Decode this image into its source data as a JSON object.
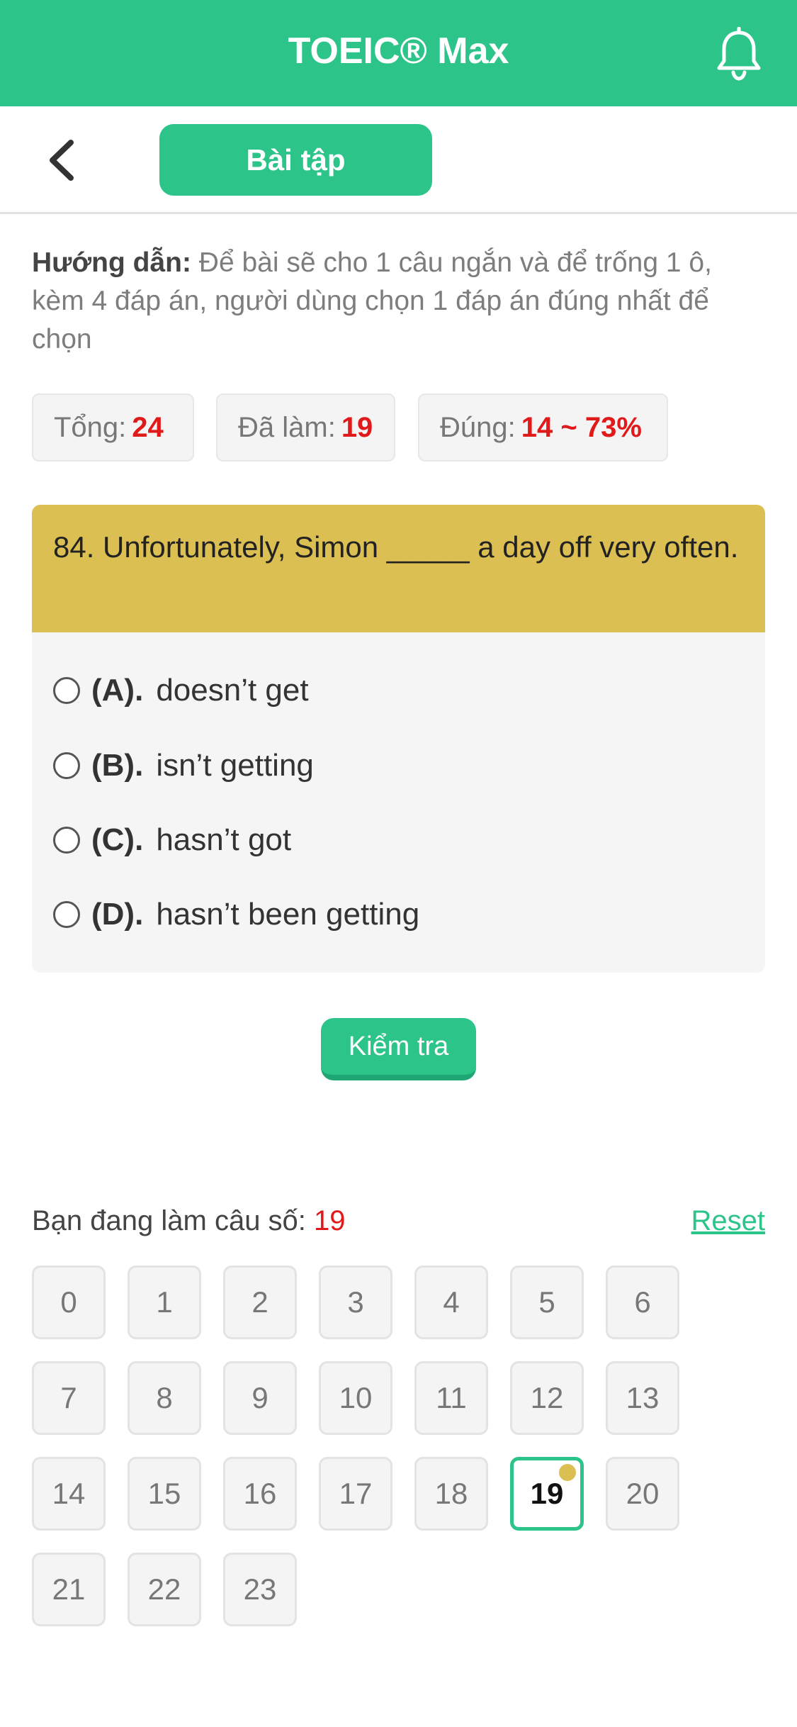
{
  "app": {
    "title": "TOEIC® Max"
  },
  "toolbar": {
    "tab_label": "Bài tập"
  },
  "instruction": {
    "label": "Hướng dẫn:",
    "text": "Để bài sẽ cho 1 câu ngắn và để trống 1 ô, kèm 4 đáp án, người dùng chọn 1 đáp án đúng nhất để chọn"
  },
  "stats": [
    {
      "label": "Tổng:",
      "value": "24"
    },
    {
      "label": "Đã làm:",
      "value": "19"
    },
    {
      "label": "Đúng:",
      "value": "14 ~ 73%"
    }
  ],
  "question": {
    "text": "84. Unfortunately, Simon _____ a day off very often.",
    "options": [
      {
        "letter": "(A).",
        "text": "doesn’t get"
      },
      {
        "letter": "(B).",
        "text": "isn’t getting"
      },
      {
        "letter": "(C).",
        "text": "hasn’t got"
      },
      {
        "letter": "(D).",
        "text": "hasn’t been getting"
      }
    ]
  },
  "check_button": {
    "label": "Kiểm tra"
  },
  "progress": {
    "label": "Bạn đang làm câu số:",
    "current": "19",
    "reset_label": "Reset"
  },
  "grid": [
    "0",
    "1",
    "2",
    "3",
    "4",
    "5",
    "6",
    "7",
    "8",
    "9",
    "10",
    "11",
    "12",
    "13",
    "14",
    "15",
    "16",
    "17",
    "18",
    "19",
    "20",
    "21",
    "22",
    "23"
  ],
  "colors": {
    "brand": "#2dc48a",
    "question_header": "#dcbf52",
    "highlight": "#e01a1a"
  },
  "icons": {
    "notifications": "bell-icon",
    "back": "chevron-left-icon"
  }
}
